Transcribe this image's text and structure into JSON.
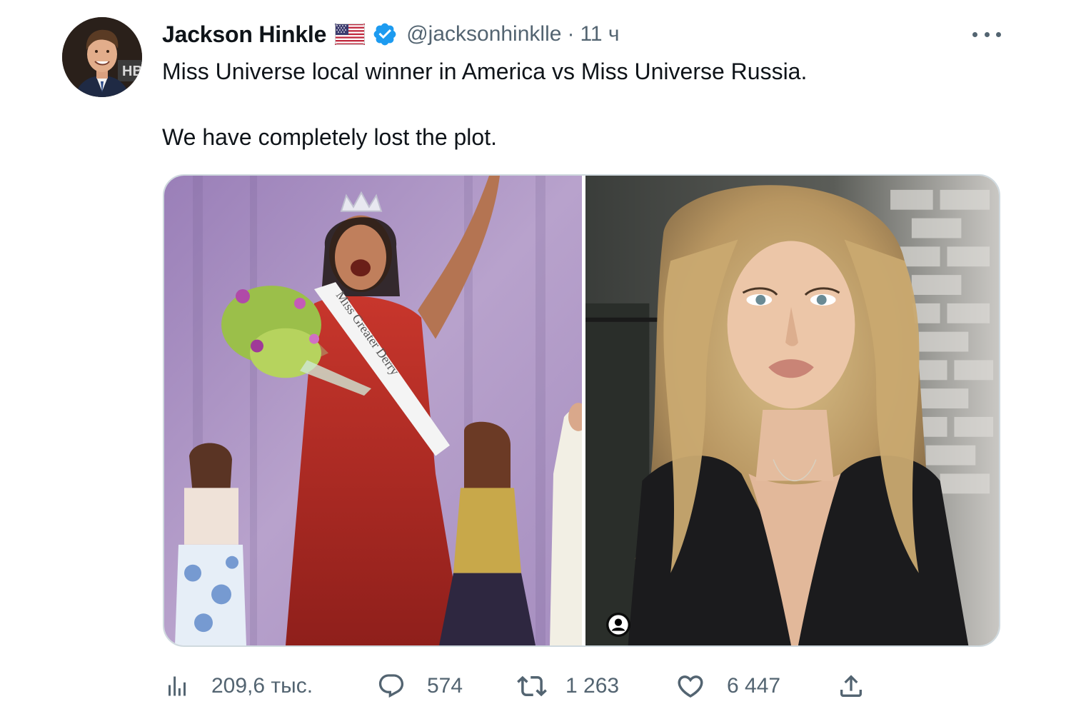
{
  "tweet": {
    "author": {
      "name": "Jackson Hinkle",
      "handle": "@jacksonhinklle",
      "time": "11 ч",
      "verified_color": "#1d9bf0"
    },
    "text": {
      "line1": "Miss Universe local winner in America vs Miss Universe Russia.",
      "line2": "We have completely lost the plot."
    },
    "media": {
      "left_photo": {
        "description_icon": "photo",
        "sash_text": "Miss Greater Derry"
      },
      "right_photo": {
        "description_icon": "photo",
        "badge_icon": "person-icon"
      }
    },
    "stats": {
      "views": "209,6 тыс.",
      "replies": "574",
      "retweets": "1 263",
      "likes": "6 447"
    }
  },
  "colors": {
    "text_primary": "#0f1419",
    "text_secondary": "#536471",
    "border": "#cfd9de",
    "accent": "#1d9bf0"
  }
}
